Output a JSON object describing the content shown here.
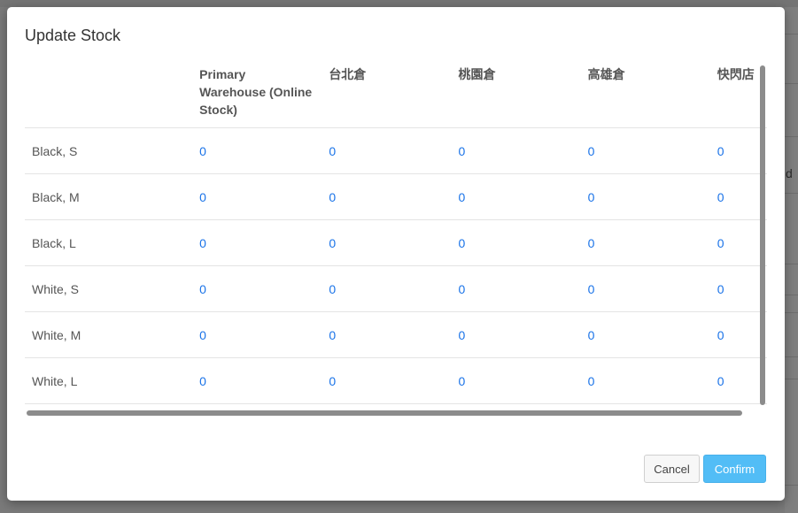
{
  "dialog": {
    "title": "Update Stock"
  },
  "table": {
    "columns": [
      {
        "label": ""
      },
      {
        "label": "Primary Warehouse (Online Stock)"
      },
      {
        "label": "台北倉"
      },
      {
        "label": "桃園倉"
      },
      {
        "label": "高雄倉"
      },
      {
        "label": "快閃店"
      }
    ],
    "rows": [
      {
        "variant": "Black, S",
        "stock": [
          "0",
          "0",
          "0",
          "0",
          "0"
        ]
      },
      {
        "variant": "Black, M",
        "stock": [
          "0",
          "0",
          "0",
          "0",
          "0"
        ]
      },
      {
        "variant": "Black, L",
        "stock": [
          "0",
          "0",
          "0",
          "0",
          "0"
        ]
      },
      {
        "variant": "White, S",
        "stock": [
          "0",
          "0",
          "0",
          "0",
          "0"
        ]
      },
      {
        "variant": "White, M",
        "stock": [
          "0",
          "0",
          "0",
          "0",
          "0"
        ]
      },
      {
        "variant": "White, L",
        "stock": [
          "0",
          "0",
          "0",
          "0",
          "0"
        ]
      }
    ]
  },
  "buttons": {
    "cancel_label": "Cancel",
    "confirm_label": "Confirm"
  },
  "background": {
    "right_fragment": "d"
  },
  "colors": {
    "link": "#1a73e8",
    "confirm_bg": "#52bdf6",
    "overlay": "rgba(0,0,0,0.5)"
  }
}
